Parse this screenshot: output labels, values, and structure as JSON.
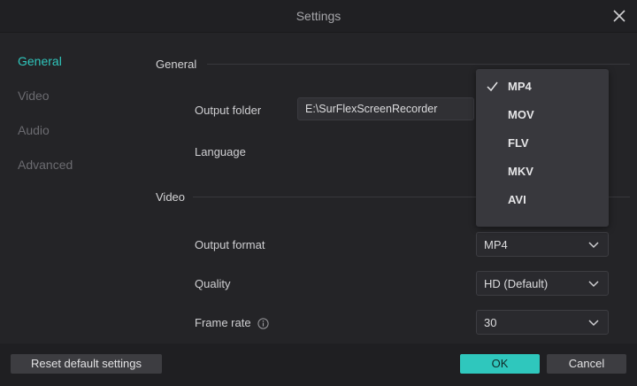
{
  "window": {
    "title": "Settings"
  },
  "sidebar": {
    "items": [
      {
        "label": "General"
      },
      {
        "label": "Video"
      },
      {
        "label": "Audio"
      },
      {
        "label": "Advanced"
      }
    ]
  },
  "general": {
    "heading": "General",
    "output_folder_label": "Output folder",
    "output_folder_value": "E:\\SurFlexScreenRecorder",
    "language_label": "Language"
  },
  "video": {
    "heading": "Video",
    "output_format_label": "Output format",
    "output_format_value": "MP4",
    "quality_label": "Quality",
    "quality_value": "HD (Default)",
    "frame_rate_label": "Frame rate",
    "frame_rate_value": "30"
  },
  "format_dropdown": {
    "selected": "MP4",
    "options": [
      "MP4",
      "MOV",
      "FLV",
      "MKV",
      "AVI"
    ]
  },
  "footer": {
    "reset_label": "Reset default settings",
    "ok_label": "OK",
    "cancel_label": "Cancel"
  },
  "colors": {
    "accent": "#2fc7bd",
    "background": "#242427",
    "footer": "#1f1f22"
  }
}
